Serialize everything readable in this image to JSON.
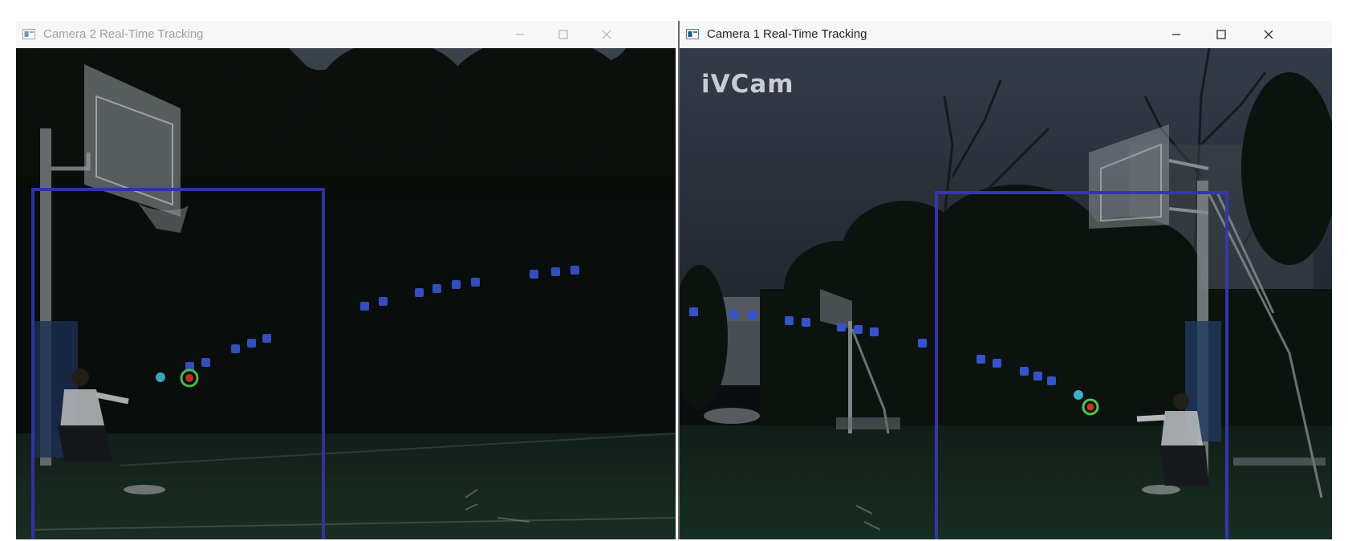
{
  "windows": {
    "camera2": {
      "title": "Camera 2 Real-Time Tracking",
      "icon": "window-app-icon",
      "active": false,
      "controls": [
        "minimize-icon",
        "maximize-icon",
        "close-icon"
      ]
    },
    "camera1": {
      "title": "Camera 1 Real-Time Tracking",
      "icon": "window-app-icon",
      "active": true,
      "controls": [
        "minimize-icon",
        "maximize-icon",
        "close-icon"
      ],
      "overlay_text": "iVCam"
    }
  },
  "colors": {
    "bounding_box": "#3c3fc4",
    "trajectory_point": "#3d5fe6",
    "detection_ring": "#5ee05a",
    "detection_center": "#e0402a",
    "prediction_point": "#46c8e8"
  }
}
